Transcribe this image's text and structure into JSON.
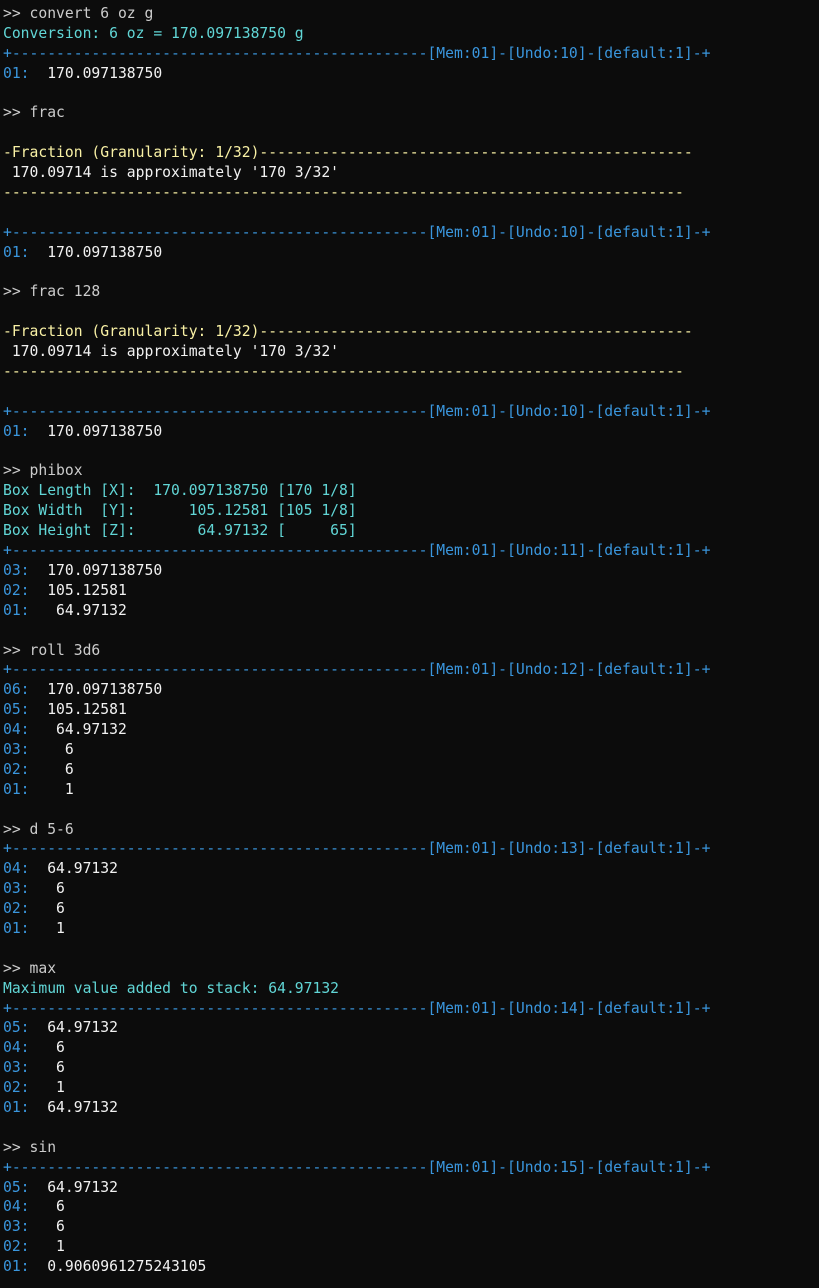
{
  "colors": {
    "background": "#0c0c0c",
    "prompt": "#cccccc",
    "info": "#61d6d6",
    "separator": "#3a96dd",
    "fraction": "#f9f1a5",
    "value": "#f2f2f2"
  },
  "lines": [
    {
      "kind": "prompt",
      "segments": [
        {
          "text": ">> convert 6 oz g",
          "color": "gray"
        }
      ]
    },
    {
      "kind": "info",
      "segments": [
        {
          "text": "Conversion: 6 oz = 170.097138750 g",
          "color": "teal"
        }
      ]
    },
    {
      "kind": "separator",
      "segments": [
        {
          "text": "+-----------------------------------------------[Mem:01]-[Undo:10]-[default:1]-+",
          "color": "cyan"
        }
      ]
    },
    {
      "kind": "stack",
      "segments": [
        {
          "text": "01:",
          "color": "cyan"
        },
        {
          "text": "  170.097138750",
          "color": "white"
        }
      ]
    },
    {
      "kind": "blank",
      "segments": []
    },
    {
      "kind": "prompt",
      "segments": [
        {
          "text": ">> frac",
          "color": "gray"
        }
      ]
    },
    {
      "kind": "blank",
      "segments": []
    },
    {
      "kind": "fraction",
      "segments": [
        {
          "text": "-Fraction (Granularity: 1/32)-------------------------------------------------",
          "color": "yellow"
        }
      ]
    },
    {
      "kind": "fraction",
      "segments": [
        {
          "text": " 170.09714 is approximately '170 3/32'",
          "color": "white"
        }
      ]
    },
    {
      "kind": "fraction",
      "segments": [
        {
          "text": "-----------------------------------------------------------------------------",
          "color": "yellow"
        }
      ]
    },
    {
      "kind": "blank",
      "segments": []
    },
    {
      "kind": "separator",
      "segments": [
        {
          "text": "+-----------------------------------------------[Mem:01]-[Undo:10]-[default:1]-+",
          "color": "cyan"
        }
      ]
    },
    {
      "kind": "stack",
      "segments": [
        {
          "text": "01:",
          "color": "cyan"
        },
        {
          "text": "  170.097138750",
          "color": "white"
        }
      ]
    },
    {
      "kind": "blank",
      "segments": []
    },
    {
      "kind": "prompt",
      "segments": [
        {
          "text": ">> frac 128",
          "color": "gray"
        }
      ]
    },
    {
      "kind": "blank",
      "segments": []
    },
    {
      "kind": "fraction",
      "segments": [
        {
          "text": "-Fraction (Granularity: 1/32)-------------------------------------------------",
          "color": "yellow"
        }
      ]
    },
    {
      "kind": "fraction",
      "segments": [
        {
          "text": " 170.09714 is approximately '170 3/32'",
          "color": "white"
        }
      ]
    },
    {
      "kind": "fraction",
      "segments": [
        {
          "text": "-----------------------------------------------------------------------------",
          "color": "yellow"
        }
      ]
    },
    {
      "kind": "blank",
      "segments": []
    },
    {
      "kind": "separator",
      "segments": [
        {
          "text": "+-----------------------------------------------[Mem:01]-[Undo:10]-[default:1]-+",
          "color": "cyan"
        }
      ]
    },
    {
      "kind": "stack",
      "segments": [
        {
          "text": "01:",
          "color": "cyan"
        },
        {
          "text": "  170.097138750",
          "color": "white"
        }
      ]
    },
    {
      "kind": "blank",
      "segments": []
    },
    {
      "kind": "prompt",
      "segments": [
        {
          "text": ">> phibox",
          "color": "gray"
        }
      ]
    },
    {
      "kind": "info",
      "segments": [
        {
          "text": "Box Length [X]:  170.097138750 [170 1/8]",
          "color": "teal"
        }
      ]
    },
    {
      "kind": "info",
      "segments": [
        {
          "text": "Box Width  [Y]:      105.12581 [105 1/8]",
          "color": "teal"
        }
      ]
    },
    {
      "kind": "info",
      "segments": [
        {
          "text": "Box Height [Z]:       64.97132 [     65]",
          "color": "teal"
        }
      ]
    },
    {
      "kind": "separator",
      "segments": [
        {
          "text": "+-----------------------------------------------[Mem:01]-[Undo:11]-[default:1]-+",
          "color": "cyan"
        }
      ]
    },
    {
      "kind": "stack",
      "segments": [
        {
          "text": "03:",
          "color": "cyan"
        },
        {
          "text": "  170.097138750",
          "color": "white"
        }
      ]
    },
    {
      "kind": "stack",
      "segments": [
        {
          "text": "02:",
          "color": "cyan"
        },
        {
          "text": "  105.12581",
          "color": "white"
        }
      ]
    },
    {
      "kind": "stack",
      "segments": [
        {
          "text": "01:",
          "color": "cyan"
        },
        {
          "text": "   64.97132",
          "color": "white"
        }
      ]
    },
    {
      "kind": "blank",
      "segments": []
    },
    {
      "kind": "prompt",
      "segments": [
        {
          "text": ">> roll 3d6",
          "color": "gray"
        }
      ]
    },
    {
      "kind": "separator",
      "segments": [
        {
          "text": "+-----------------------------------------------[Mem:01]-[Undo:12]-[default:1]-+",
          "color": "cyan"
        }
      ]
    },
    {
      "kind": "stack",
      "segments": [
        {
          "text": "06:",
          "color": "cyan"
        },
        {
          "text": "  170.097138750",
          "color": "white"
        }
      ]
    },
    {
      "kind": "stack",
      "segments": [
        {
          "text": "05:",
          "color": "cyan"
        },
        {
          "text": "  105.12581",
          "color": "white"
        }
      ]
    },
    {
      "kind": "stack",
      "segments": [
        {
          "text": "04:",
          "color": "cyan"
        },
        {
          "text": "   64.97132",
          "color": "white"
        }
      ]
    },
    {
      "kind": "stack",
      "segments": [
        {
          "text": "03:",
          "color": "cyan"
        },
        {
          "text": "    6",
          "color": "white"
        }
      ]
    },
    {
      "kind": "stack",
      "segments": [
        {
          "text": "02:",
          "color": "cyan"
        },
        {
          "text": "    6",
          "color": "white"
        }
      ]
    },
    {
      "kind": "stack",
      "segments": [
        {
          "text": "01:",
          "color": "cyan"
        },
        {
          "text": "    1",
          "color": "white"
        }
      ]
    },
    {
      "kind": "blank",
      "segments": []
    },
    {
      "kind": "prompt",
      "segments": [
        {
          "text": ">> d 5-6",
          "color": "gray"
        }
      ]
    },
    {
      "kind": "separator",
      "segments": [
        {
          "text": "+-----------------------------------------------[Mem:01]-[Undo:13]-[default:1]-+",
          "color": "cyan"
        }
      ]
    },
    {
      "kind": "stack",
      "segments": [
        {
          "text": "04:",
          "color": "cyan"
        },
        {
          "text": "  64.97132",
          "color": "white"
        }
      ]
    },
    {
      "kind": "stack",
      "segments": [
        {
          "text": "03:",
          "color": "cyan"
        },
        {
          "text": "   6",
          "color": "white"
        }
      ]
    },
    {
      "kind": "stack",
      "segments": [
        {
          "text": "02:",
          "color": "cyan"
        },
        {
          "text": "   6",
          "color": "white"
        }
      ]
    },
    {
      "kind": "stack",
      "segments": [
        {
          "text": "01:",
          "color": "cyan"
        },
        {
          "text": "   1",
          "color": "white"
        }
      ]
    },
    {
      "kind": "blank",
      "segments": []
    },
    {
      "kind": "prompt",
      "segments": [
        {
          "text": ">> max",
          "color": "gray"
        }
      ]
    },
    {
      "kind": "info",
      "segments": [
        {
          "text": "Maximum value added to stack: 64.97132",
          "color": "teal"
        }
      ]
    },
    {
      "kind": "separator",
      "segments": [
        {
          "text": "+-----------------------------------------------[Mem:01]-[Undo:14]-[default:1]-+",
          "color": "cyan"
        }
      ]
    },
    {
      "kind": "stack",
      "segments": [
        {
          "text": "05:",
          "color": "cyan"
        },
        {
          "text": "  64.97132",
          "color": "white"
        }
      ]
    },
    {
      "kind": "stack",
      "segments": [
        {
          "text": "04:",
          "color": "cyan"
        },
        {
          "text": "   6",
          "color": "white"
        }
      ]
    },
    {
      "kind": "stack",
      "segments": [
        {
          "text": "03:",
          "color": "cyan"
        },
        {
          "text": "   6",
          "color": "white"
        }
      ]
    },
    {
      "kind": "stack",
      "segments": [
        {
          "text": "02:",
          "color": "cyan"
        },
        {
          "text": "   1",
          "color": "white"
        }
      ]
    },
    {
      "kind": "stack",
      "segments": [
        {
          "text": "01:",
          "color": "cyan"
        },
        {
          "text": "  64.97132",
          "color": "white"
        }
      ]
    },
    {
      "kind": "blank",
      "segments": []
    },
    {
      "kind": "prompt",
      "segments": [
        {
          "text": ">> sin",
          "color": "gray"
        }
      ]
    },
    {
      "kind": "separator",
      "segments": [
        {
          "text": "+-----------------------------------------------[Mem:01]-[Undo:15]-[default:1]-+",
          "color": "cyan"
        }
      ]
    },
    {
      "kind": "stack",
      "segments": [
        {
          "text": "05:",
          "color": "cyan"
        },
        {
          "text": "  64.97132",
          "color": "white"
        }
      ]
    },
    {
      "kind": "stack",
      "segments": [
        {
          "text": "04:",
          "color": "cyan"
        },
        {
          "text": "   6",
          "color": "white"
        }
      ]
    },
    {
      "kind": "stack",
      "segments": [
        {
          "text": "03:",
          "color": "cyan"
        },
        {
          "text": "   6",
          "color": "white"
        }
      ]
    },
    {
      "kind": "stack",
      "segments": [
        {
          "text": "02:",
          "color": "cyan"
        },
        {
          "text": "   1",
          "color": "white"
        }
      ]
    },
    {
      "kind": "stack",
      "segments": [
        {
          "text": "01:",
          "color": "cyan"
        },
        {
          "text": "  0.9060961275243105",
          "color": "white"
        }
      ]
    }
  ]
}
